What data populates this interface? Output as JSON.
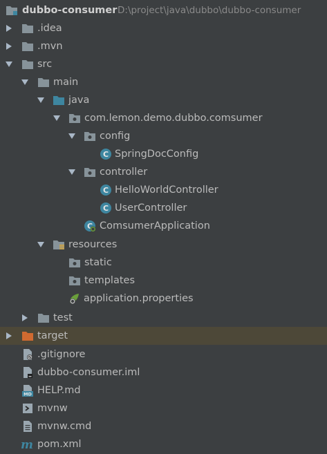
{
  "project": {
    "name": "dubbo-consumer",
    "path": "D:\\project\\java\\dubbo\\dubbo-consumer"
  },
  "tree": {
    "idea": ".idea",
    "mvn": ".mvn",
    "src": "src",
    "main": "main",
    "java": "java",
    "package": "com.lemon.demo.dubbo.comsumer",
    "config": "config",
    "springdocconfig": "SpringDocConfig",
    "controller": "controller",
    "helloworldcontroller": "HelloWorldController",
    "usercontroller": "UserController",
    "comsumerapplication": "ComsumerApplication",
    "resources": "resources",
    "static": "static",
    "templates": "templates",
    "application_properties": "application.properties",
    "test": "test",
    "target": "target",
    "gitignore": ".gitignore",
    "iml": "dubbo-consumer.iml",
    "help": "HELP.md",
    "mvnw": "mvnw",
    "mvnw_cmd": "mvnw.cmd",
    "pom": "pom.xml"
  },
  "icons": {
    "help_badge": "MD",
    "pom_badge": "m",
    "class_badge": "C"
  },
  "colors": {
    "background": "#3c3f41",
    "text": "#bbbbbb",
    "folder": "#87939a",
    "source_folder": "#3e86a0",
    "class": "#3e86a0",
    "target_folder": "#d06a30",
    "selected_row": "#4b473d"
  }
}
